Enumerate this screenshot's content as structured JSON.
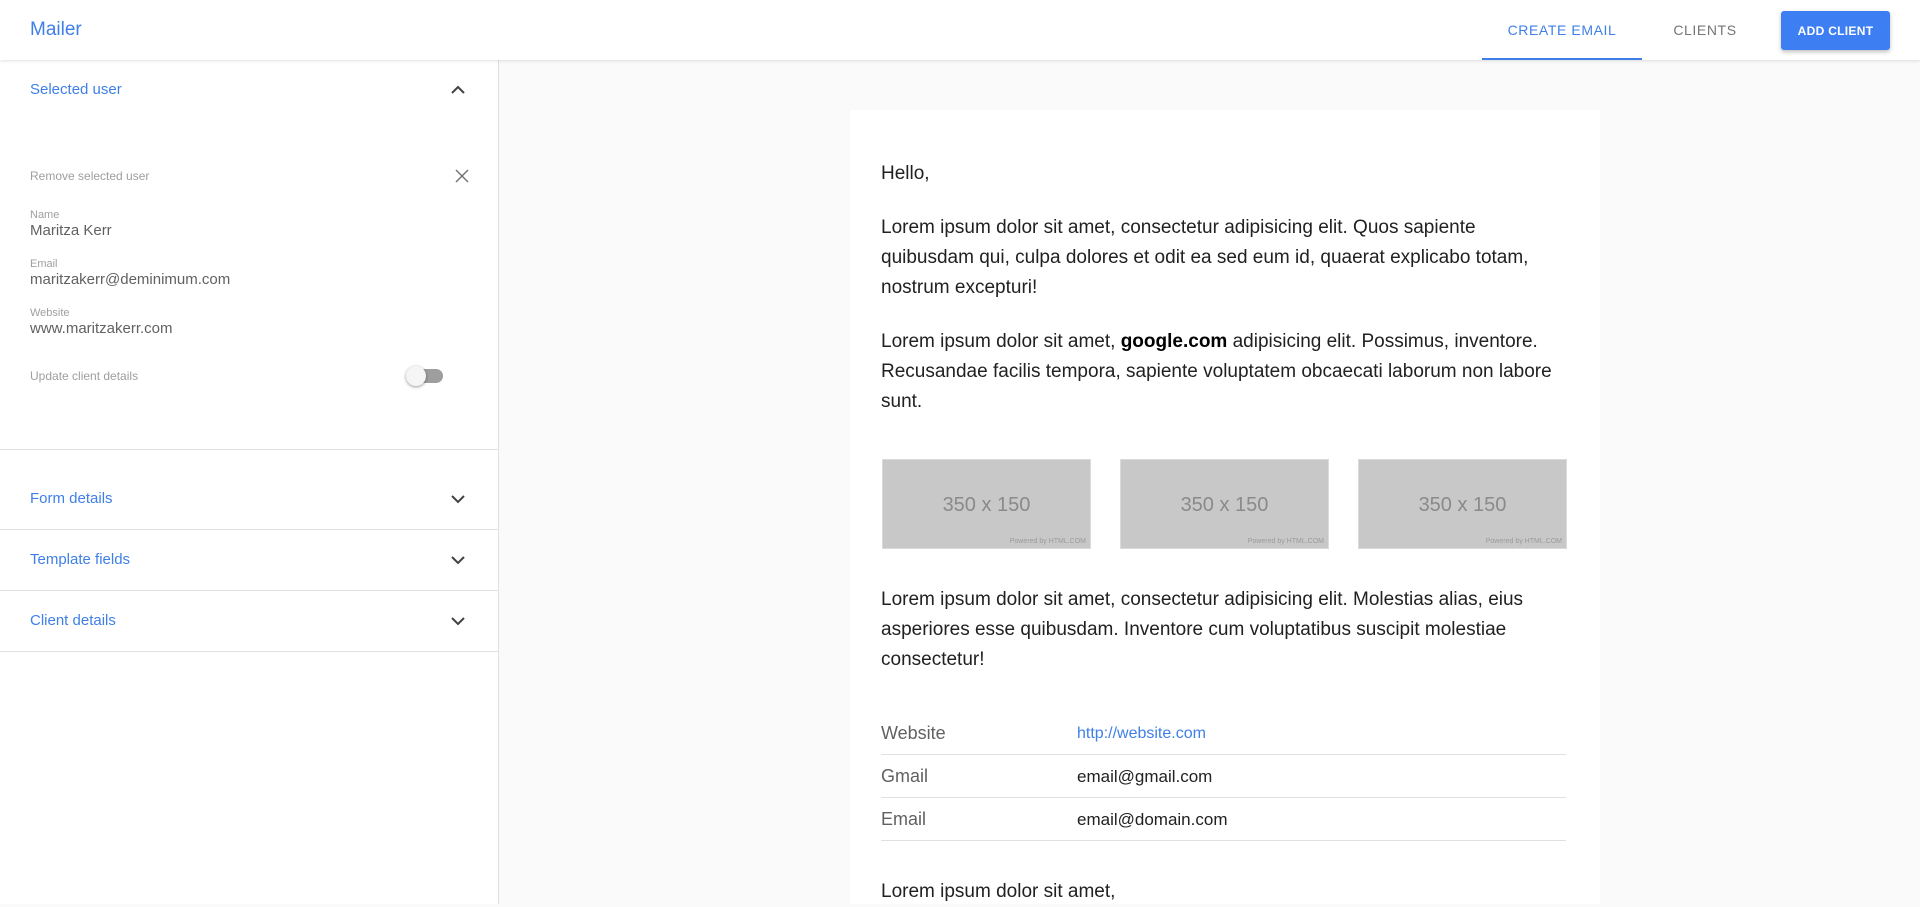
{
  "app": {
    "title": "Mailer"
  },
  "nav": {
    "tabs": [
      {
        "label": "CREATE EMAIL",
        "active": true
      },
      {
        "label": "CLIENTS",
        "active": false
      }
    ],
    "add_client_label": "ADD CLIENT"
  },
  "colors": {
    "accent": "#3f7fe8",
    "button": "#3d7ff3"
  },
  "sidebar": {
    "selected_user": {
      "title": "Selected user",
      "expanded": true,
      "remove_label": "Remove selected user",
      "name_label": "Name",
      "name_value": "Maritza Kerr",
      "email_label": "Email",
      "email_value": "maritzakerr@deminimum.com",
      "website_label": "Website",
      "website_value": "www.maritzakerr.com",
      "update_label": "Update client details",
      "update_enabled": false
    },
    "panels": [
      {
        "title": "Form details",
        "expanded": false
      },
      {
        "title": "Template fields",
        "expanded": false
      },
      {
        "title": "Client details",
        "expanded": false
      }
    ]
  },
  "email": {
    "greeting": "Hello,",
    "para1": "Lorem ipsum dolor sit amet, consectetur adipisicing elit. Quos sapiente quibusdam qui, culpa dolores et odit ea sed eum id, quaerat explicabo totam, nostrum excepturi!",
    "para2_prefix": "Lorem ipsum dolor sit amet, ",
    "para2_bold": "google.com",
    "para2_suffix": " adipisicing elit. Possimus, inventore. Recusandae facilis tempora, sapiente voluptatem obcaecati laborum non labore sunt.",
    "images": [
      {
        "label": "350 x 150",
        "credit": "Powered by HTML.COM"
      },
      {
        "label": "350 x 150",
        "credit": "Powered by HTML.COM"
      },
      {
        "label": "350 x 150",
        "credit": "Powered by HTML.COM"
      }
    ],
    "para3": "Lorem ipsum dolor sit amet, consectetur adipisicing elit. Molestias alias, eius asperiores esse quibusdam. Inventore cum voluptatibus suscipit molestiae consectetur!",
    "info_rows": [
      {
        "key": "Website",
        "value": "http://website.com"
      },
      {
        "key": "Gmail",
        "value": "email@gmail.com"
      },
      {
        "key": "Email",
        "value": "email@domain.com"
      }
    ],
    "closing": "Lorem ipsum dolor sit amet,"
  }
}
